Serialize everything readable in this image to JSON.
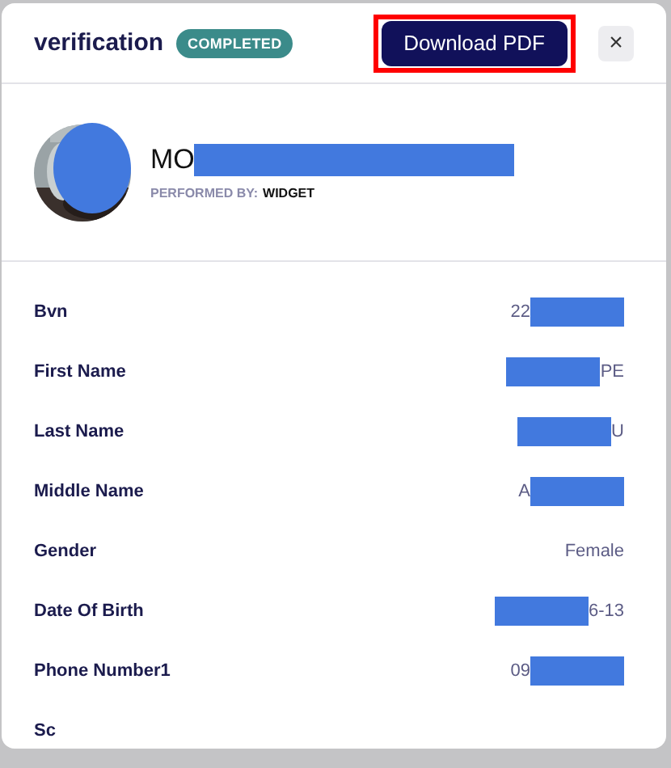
{
  "header": {
    "title": "verification",
    "status_badge": "COMPLETED",
    "download_button": "Download PDF",
    "highlighted": true,
    "close_button": "×"
  },
  "profile": {
    "avatar": {
      "redacted": true
    },
    "name": "MO",
    "name_redacted": true,
    "performed_by_label": "PERFORMED BY:",
    "performed_by_value": "WIDGET"
  },
  "fields": [
    {
      "label": "Bvn",
      "value": "22",
      "redacted_before": false,
      "redacted_after": true
    },
    {
      "label": "First Name",
      "value": "PE",
      "redacted_before": true,
      "redacted_after": false
    },
    {
      "label": "Last Name",
      "value": "U",
      "redacted_before": true,
      "redacted_after": false
    },
    {
      "label": "Middle Name",
      "value": "A",
      "redacted_before": false,
      "redacted_after": true
    },
    {
      "label": "Gender",
      "value": "Female",
      "redacted_before": false,
      "redacted_after": false
    },
    {
      "label": "Date Of Birth",
      "value": "6-13",
      "redacted_before": true,
      "redacted_after": false
    },
    {
      "label": "Phone Number1",
      "value": "09",
      "redacted_before": false,
      "redacted_after": true
    },
    {
      "label": "Sc",
      "redacted_before": false,
      "redacted_after": false
    }
  ]
}
